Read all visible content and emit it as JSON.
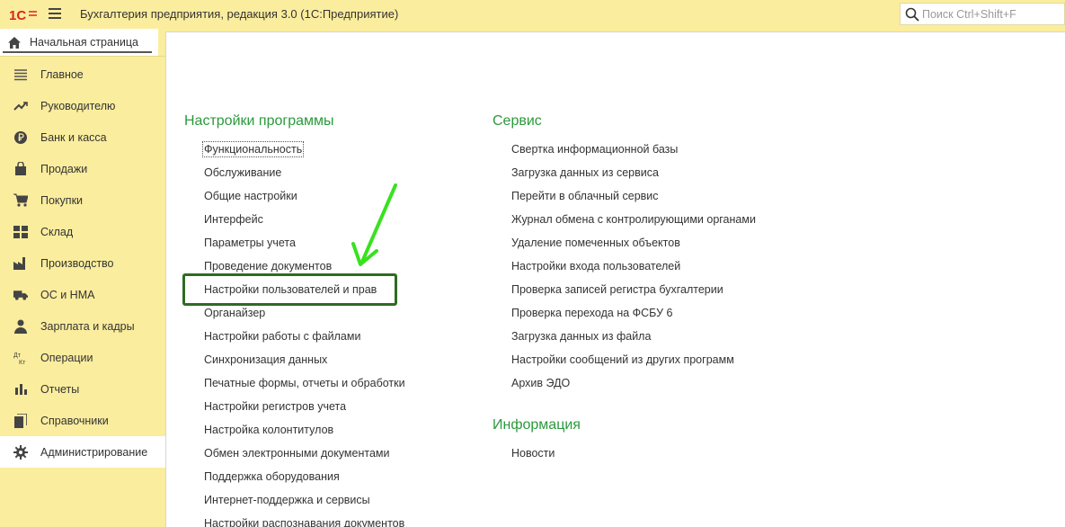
{
  "app": {
    "title": "Бухгалтерия предприятия, редакция 3.0  (1С:Предприятие)",
    "search_placeholder": "Поиск Ctrl+Shift+F"
  },
  "home_tab": {
    "label": "Начальная страница"
  },
  "sidebar": {
    "items": [
      {
        "label": "Главное",
        "icon": "menu-lines-icon"
      },
      {
        "label": "Руководителю",
        "icon": "trend-icon"
      },
      {
        "label": "Банк и касса",
        "icon": "ruble-coin-icon"
      },
      {
        "label": "Продажи",
        "icon": "shopping-bag-icon"
      },
      {
        "label": "Покупки",
        "icon": "cart-icon"
      },
      {
        "label": "Склад",
        "icon": "warehouse-icon"
      },
      {
        "label": "Производство",
        "icon": "factory-icon"
      },
      {
        "label": "ОС и НМА",
        "icon": "truck-icon"
      },
      {
        "label": "Зарплата и кадры",
        "icon": "person-icon"
      },
      {
        "label": "Операции",
        "icon": "dt-kt-icon"
      },
      {
        "label": "Отчеты",
        "icon": "bar-chart-icon"
      },
      {
        "label": "Справочники",
        "icon": "books-icon"
      },
      {
        "label": "Администрирование",
        "icon": "gear-icon",
        "active": true
      }
    ]
  },
  "main": {
    "settings": {
      "title": "Настройки программы",
      "links": [
        "Функциональность",
        "Обслуживание",
        "Общие настройки",
        "Интерфейс",
        "Параметры учета",
        "Проведение документов",
        "Настройки пользователей и прав",
        "Органайзер",
        "Настройки работы с файлами",
        "Синхронизация данных",
        "Печатные формы, отчеты и обработки",
        "Настройки регистров учета",
        "Настройка колонтитулов",
        "Обмен электронными документами",
        "Поддержка оборудования",
        "Интернет-поддержка и сервисы",
        "Настройки распознавания документов"
      ]
    },
    "service": {
      "title": "Сервис",
      "links": [
        "Свертка информационной базы",
        "Загрузка данных из сервиса",
        "Перейти в облачный сервис",
        "Журнал обмена с контролирующими органами",
        "Удаление помеченных объектов",
        "Настройки входа пользователей",
        "Проверка записей регистра бухгалтерии",
        "Проверка перехода на ФСБУ 6",
        "Загрузка данных из файла",
        "Настройки сообщений из других программ",
        "Архив ЭДО"
      ]
    },
    "info": {
      "title": "Информация",
      "links": [
        "Новости"
      ]
    }
  },
  "colors": {
    "accent_green": "#2a9a3c",
    "panel_yellow": "#fbed9e",
    "highlight_box": "#2e6b22",
    "arrow_green": "#39e11f"
  }
}
